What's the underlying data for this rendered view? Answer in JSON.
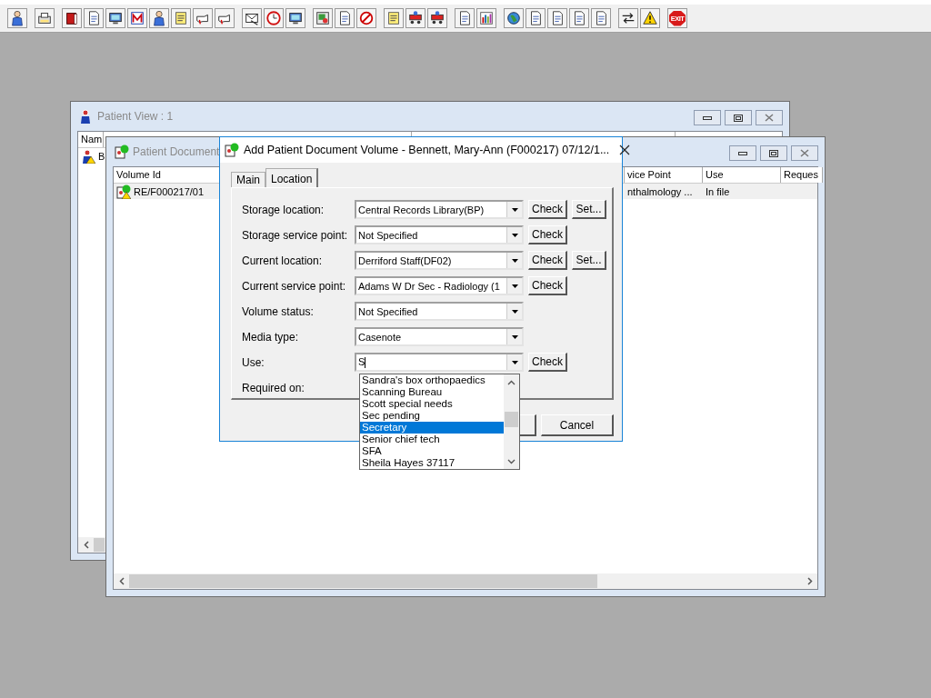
{
  "toolbar": {
    "exit_label": "EXIT"
  },
  "patient_view": {
    "title": "Patient View : 1",
    "column_1": "Nam",
    "row_1": "B"
  },
  "patient_documents": {
    "title": "Patient Document",
    "columns": [
      "Volume Id",
      "vice Point",
      "Use",
      "Reques"
    ],
    "rows": [
      {
        "cells": [
          "RE/F000217/01",
          "nthalmology ...",
          "In file"
        ],
        "selected": true
      }
    ]
  },
  "dialog": {
    "title": "Add Patient Document Volume - Bennett, Mary-Ann (F000217) 07/12/1...",
    "tabs": [
      {
        "label": "Main",
        "selected": false
      },
      {
        "label": "Location",
        "selected": true
      }
    ],
    "fields": [
      {
        "label": "Storage location:",
        "value": "Central Records Library(BP)",
        "buttons": [
          "Check",
          "Set..."
        ]
      },
      {
        "label": "Storage service point:",
        "value": "Not Specified",
        "buttons": [
          "Check"
        ]
      },
      {
        "label": "Current location:",
        "value": "Derriford Staff(DF02)",
        "buttons": [
          "Check",
          "Set..."
        ]
      },
      {
        "label": "Current service point:",
        "value": "Adams W Dr Sec - Radiology (1",
        "buttons": [
          "Check"
        ]
      },
      {
        "label": "Volume status:",
        "value": "Not Specified"
      },
      {
        "label": "Media type:",
        "value": "Casenote"
      },
      {
        "label": "Use:",
        "value": "S",
        "buttons": [
          "Check"
        ],
        "focused": true
      },
      {
        "label": "Required on:"
      }
    ],
    "buttons": [
      "Cancel"
    ],
    "dropdown": [
      {
        "label": "Sandra's box orthopaedics",
        "selected": false
      },
      {
        "label": "Scanning Bureau",
        "selected": false
      },
      {
        "label": "Scott special needs",
        "selected": false
      },
      {
        "label": "Sec pending",
        "selected": false
      },
      {
        "label": "Secretary",
        "selected": true
      },
      {
        "label": "Senior chief tech",
        "selected": false
      },
      {
        "label": "SFA",
        "selected": false
      },
      {
        "label": "Sheila Hayes 37117",
        "selected": false
      }
    ]
  }
}
